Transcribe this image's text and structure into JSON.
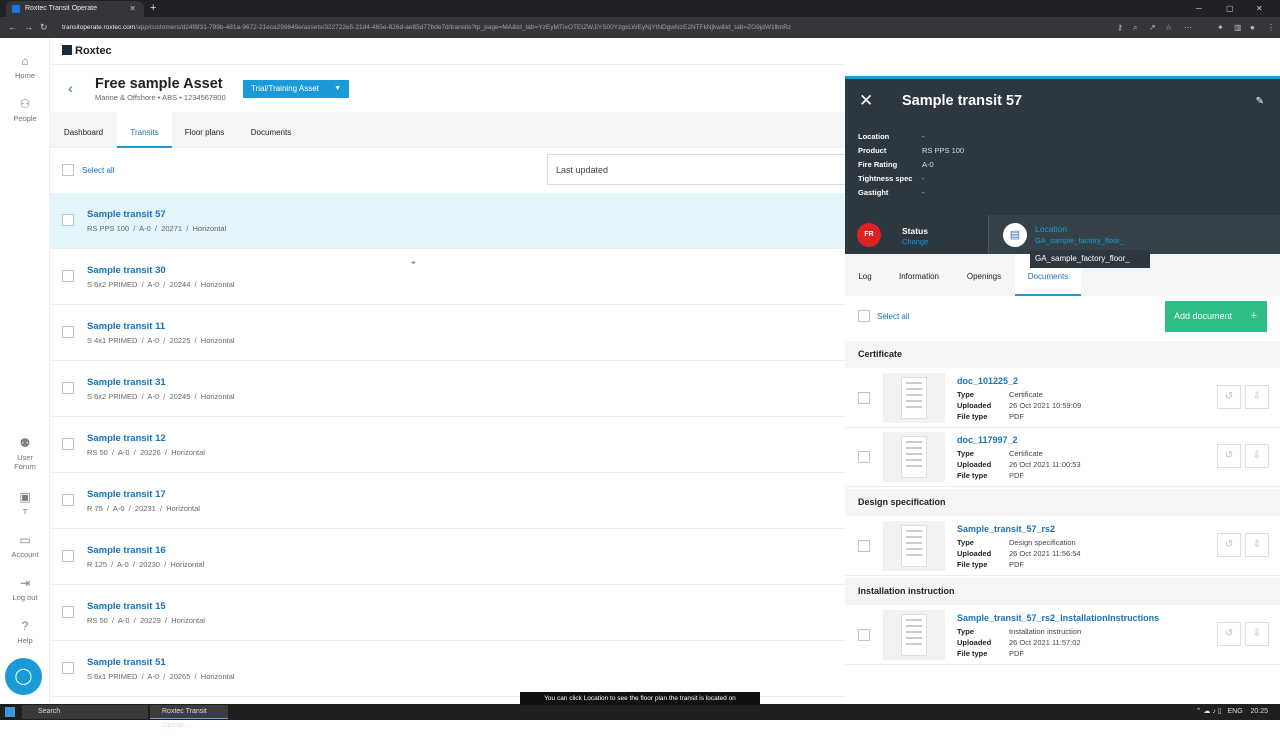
{
  "browser": {
    "tab_title": "Roxtec Transit Operate",
    "url_host": "transitoperate.roxtec.com",
    "url_path": "/app/customers/d24f8f31-799b-481a-9672-21eca299649e/assets/322722e5-21d4-465e-826d-ae85d77bde7d/transits?tp_page=MA&td_tab=YzEyMTIxOTEtZWJiYS00YzgxLWEyNjYtNDgwNzE2NTFkNjkw&td_tab=ZG9jdW1lbnRz"
  },
  "sidenav": {
    "items": [
      {
        "label": "Home"
      },
      {
        "label": "People"
      },
      {
        "label": "User Forum"
      },
      {
        "label": "T"
      },
      {
        "label": "Account"
      },
      {
        "label": "Log out"
      },
      {
        "label": "Help"
      }
    ]
  },
  "main": {
    "logo": "Roxtec",
    "asset_title": "Free sample Asset",
    "asset_subtitle": "Marine & Offshore • ABS • 1234567800",
    "asset_type_button": "Trial/Training Asset",
    "tabs": [
      {
        "label": "Dashboard"
      },
      {
        "label": "Transits"
      },
      {
        "label": "Floor plans"
      },
      {
        "label": "Documents"
      }
    ],
    "select_all": "Select all",
    "sort": "Last updated",
    "transits": [
      {
        "title": "Sample transit 57",
        "sub": "RS PPS 100  /  A-0  /  20271  /  Horizontal"
      },
      {
        "title": "Sample transit 30",
        "sub": "S 6x2 PRIMED  /  A-0  /  20244  /  Horizontal"
      },
      {
        "title": "Sample transit 11",
        "sub": "S 4x1 PRIMED  /  A-0  /  20225  /  Horizontal"
      },
      {
        "title": "Sample transit 31",
        "sub": "S 6x2 PRIMED  /  A-0  /  20245  /  Horizontal"
      },
      {
        "title": "Sample transit 12",
        "sub": "RS 50  /  A-0  /  20226  /  Horizontal"
      },
      {
        "title": "Sample transit 17",
        "sub": "R 75  /  A-0  /  20231  /  Horizontal"
      },
      {
        "title": "Sample transit 16",
        "sub": "R 125  /  A-0  /  20230  /  Horizontal"
      },
      {
        "title": "Sample transit 15",
        "sub": "RS 50  /  A-0  /  20229  /  Horizontal"
      },
      {
        "title": "Sample transit 51",
        "sub": "S 6x1 PRIMED  /  A-0  /  20265  /  Horizontal"
      }
    ]
  },
  "panel": {
    "title": "Sample transit 57",
    "props": [
      {
        "key": "Location",
        "value": "-"
      },
      {
        "key": "Product",
        "value": "RS PPS 100"
      },
      {
        "key": "Fire Rating",
        "value": "A-0"
      },
      {
        "key": "Tightness spec",
        "value": "-"
      },
      {
        "key": "Gastight",
        "value": "-"
      }
    ],
    "status_badge": "FR",
    "status_label": "Status",
    "status_change": "Change",
    "location_label": "Location",
    "location_value": "GA_sample_factory_floor_",
    "tooltip": "GA_sample_factory_floor_",
    "tabs": [
      {
        "label": "Log"
      },
      {
        "label": "Information"
      },
      {
        "label": "Openings"
      },
      {
        "label": "Documents"
      }
    ],
    "select_all": "Select all",
    "add_document": "Add document",
    "sections": [
      {
        "title": "Certificate"
      },
      {
        "title": "Design specification"
      },
      {
        "title": "Installation instruction"
      }
    ],
    "doc_keys": {
      "type": "Type",
      "uploaded": "Uploaded",
      "file_type": "File type"
    },
    "documents": [
      {
        "name": "doc_101225_2",
        "type": "Certificate",
        "uploaded": "26 Oct 2021 10:59:09",
        "file_type": "PDF"
      },
      {
        "name": "doc_117997_2",
        "type": "Certificate",
        "uploaded": "26 Oct 2021 11:00:53",
        "file_type": "PDF"
      },
      {
        "name": "Sample_transit_57_rs2",
        "type": "Design specification",
        "uploaded": "26 Oct 2021 11:56:54",
        "file_type": "PDF"
      },
      {
        "name": "Sample_transit_57_rs2_InstallationInstructions",
        "type": "Installation instruction",
        "uploaded": "26 Oct 2021 11:57:02",
        "file_type": "PDF"
      }
    ]
  },
  "hint": "You can click Location to see the floor plan the transit is located on",
  "taskbar": {
    "search": "Search",
    "app": "Roxtec Transit Operat...",
    "lang": "ENG",
    "time": "20:25"
  },
  "colors": {
    "accent": "#1a9ad6",
    "panel_bg": "#2c373f",
    "add_button": "#2ebd82",
    "status": "#dd2222"
  }
}
